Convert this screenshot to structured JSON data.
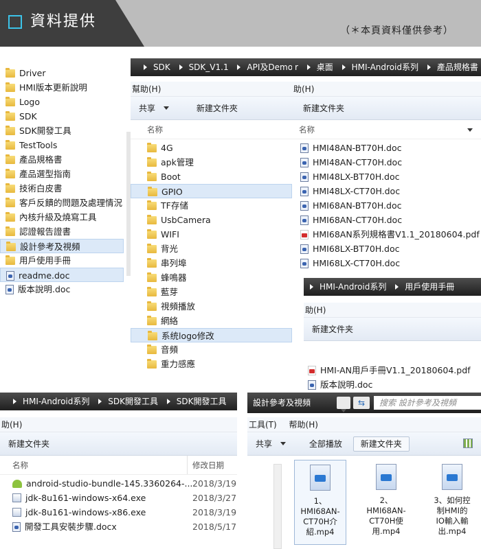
{
  "header": {
    "title": "資料提供",
    "note": "（＊本頁資料僅供參考）"
  },
  "panel1": {
    "items": [
      {
        "label": "Driver",
        "type": "folder"
      },
      {
        "label": "HMI版本更新說明",
        "type": "folder"
      },
      {
        "label": "Logo",
        "type": "folder"
      },
      {
        "label": "SDK",
        "type": "folder"
      },
      {
        "label": "SDK開發工具",
        "type": "folder"
      },
      {
        "label": "TestTools",
        "type": "folder"
      },
      {
        "label": "產品規格書",
        "type": "folder"
      },
      {
        "label": "產品選型指南",
        "type": "folder"
      },
      {
        "label": "技術白皮書",
        "type": "folder"
      },
      {
        "label": "客戶反饋的問題及處理情況",
        "type": "folder"
      },
      {
        "label": "內核升級及燒寫工具",
        "type": "folder"
      },
      {
        "label": "認證報告證書",
        "type": "folder"
      },
      {
        "label": "設計參考及視頻",
        "type": "folder"
      },
      {
        "label": "用戶使用手冊",
        "type": "folder"
      },
      {
        "label": "readme.doc",
        "type": "doc"
      },
      {
        "label": "版本說明.doc",
        "type": "doc"
      }
    ]
  },
  "panel2": {
    "breadcrumb": [
      "SDK",
      "SDK_V1.1",
      "API及Demo"
    ],
    "menu": [
      "幫助(H)"
    ],
    "toolbar": [
      "共享",
      "新建文件夾"
    ],
    "col_name": "名称",
    "items": [
      "4G",
      "apk管理",
      "Boot",
      "GPIO",
      "TF存储",
      "UsbCamera",
      "WIFI",
      "背光",
      "串列埠",
      "蜂鳴器",
      "藍芽",
      "視頻播放",
      "網絡",
      "系统logo修改",
      "音頻",
      "重力感應"
    ]
  },
  "panel3": {
    "breadcrumb_prefix": "r",
    "breadcrumb": [
      "桌面",
      "HMI-Android系列",
      "產品規格書"
    ],
    "menu": [
      "助(H)"
    ],
    "toolbar": [
      "新建文件夹"
    ],
    "col_name": "名称",
    "items": [
      {
        "label": "HMI48AN-BT70H.doc",
        "type": "doc"
      },
      {
        "label": "HMI48AN-CT70H.doc",
        "type": "doc"
      },
      {
        "label": "HMI48LX-BT70H.doc",
        "type": "doc"
      },
      {
        "label": "HMI48LX-CT70H.doc",
        "type": "doc"
      },
      {
        "label": "HMI68AN-BT70H.doc",
        "type": "doc"
      },
      {
        "label": "HMI68AN-CT70H.doc",
        "type": "doc"
      },
      {
        "label": "HMI68AN系列規格書V1.1_20180604.pdf",
        "type": "pdf"
      },
      {
        "label": "HMI68LX-BT70H.doc",
        "type": "doc"
      },
      {
        "label": "HMI68LX-CT70H.doc",
        "type": "doc"
      }
    ]
  },
  "panel4": {
    "breadcrumb": [
      "HMI-Android系列",
      "用戶使用手冊"
    ],
    "menu": [
      "助(H)"
    ],
    "toolbar": [
      "新建文件夹"
    ],
    "items": [
      {
        "label": "HMI-AN用戶手冊V1.1_20180604.pdf",
        "type": "pdf"
      },
      {
        "label": "版本說明.doc",
        "type": "doc"
      }
    ]
  },
  "panel5": {
    "breadcrumb": [
      "HMI-Android系列",
      "SDK開發工具",
      "SDK開發工具"
    ],
    "menu": [
      "助(H)"
    ],
    "toolbar": [
      "新建文件夹"
    ],
    "col_name": "名称",
    "col_date": "修改日期",
    "items": [
      {
        "label": "android-studio-bundle-145.3360264-...",
        "date": "2018/3/19",
        "type": "android"
      },
      {
        "label": "jdk-8u161-windows-x64.exe",
        "date": "2018/3/27",
        "type": "exe"
      },
      {
        "label": "jdk-8u161-windows-x86.exe",
        "date": "2018/3/19",
        "type": "exe"
      },
      {
        "label": "開發工具安裝步驟.docx",
        "date": "2018/5/17",
        "type": "doc"
      }
    ]
  },
  "panel6": {
    "address": "設計參考及視頻",
    "search_placeholder": "搜索 設計參考及視頻",
    "menu": [
      "工具(T)",
      "帮助(H)"
    ],
    "toolbar": [
      "共享",
      "全部播放",
      "新建文件夹"
    ],
    "videos": [
      {
        "line1": "1、",
        "line2": "HMI68AN-",
        "line3": "CT70H介",
        "line4": "紹.mp4"
      },
      {
        "line1": "2、",
        "line2": "HMI68AN-",
        "line3": "CT70H使",
        "line4": "用.mp4"
      },
      {
        "line1": "3、如何控",
        "line2": "制HMI的",
        "line3": "IO輸入輸",
        "line4": "出.mp4"
      }
    ]
  }
}
